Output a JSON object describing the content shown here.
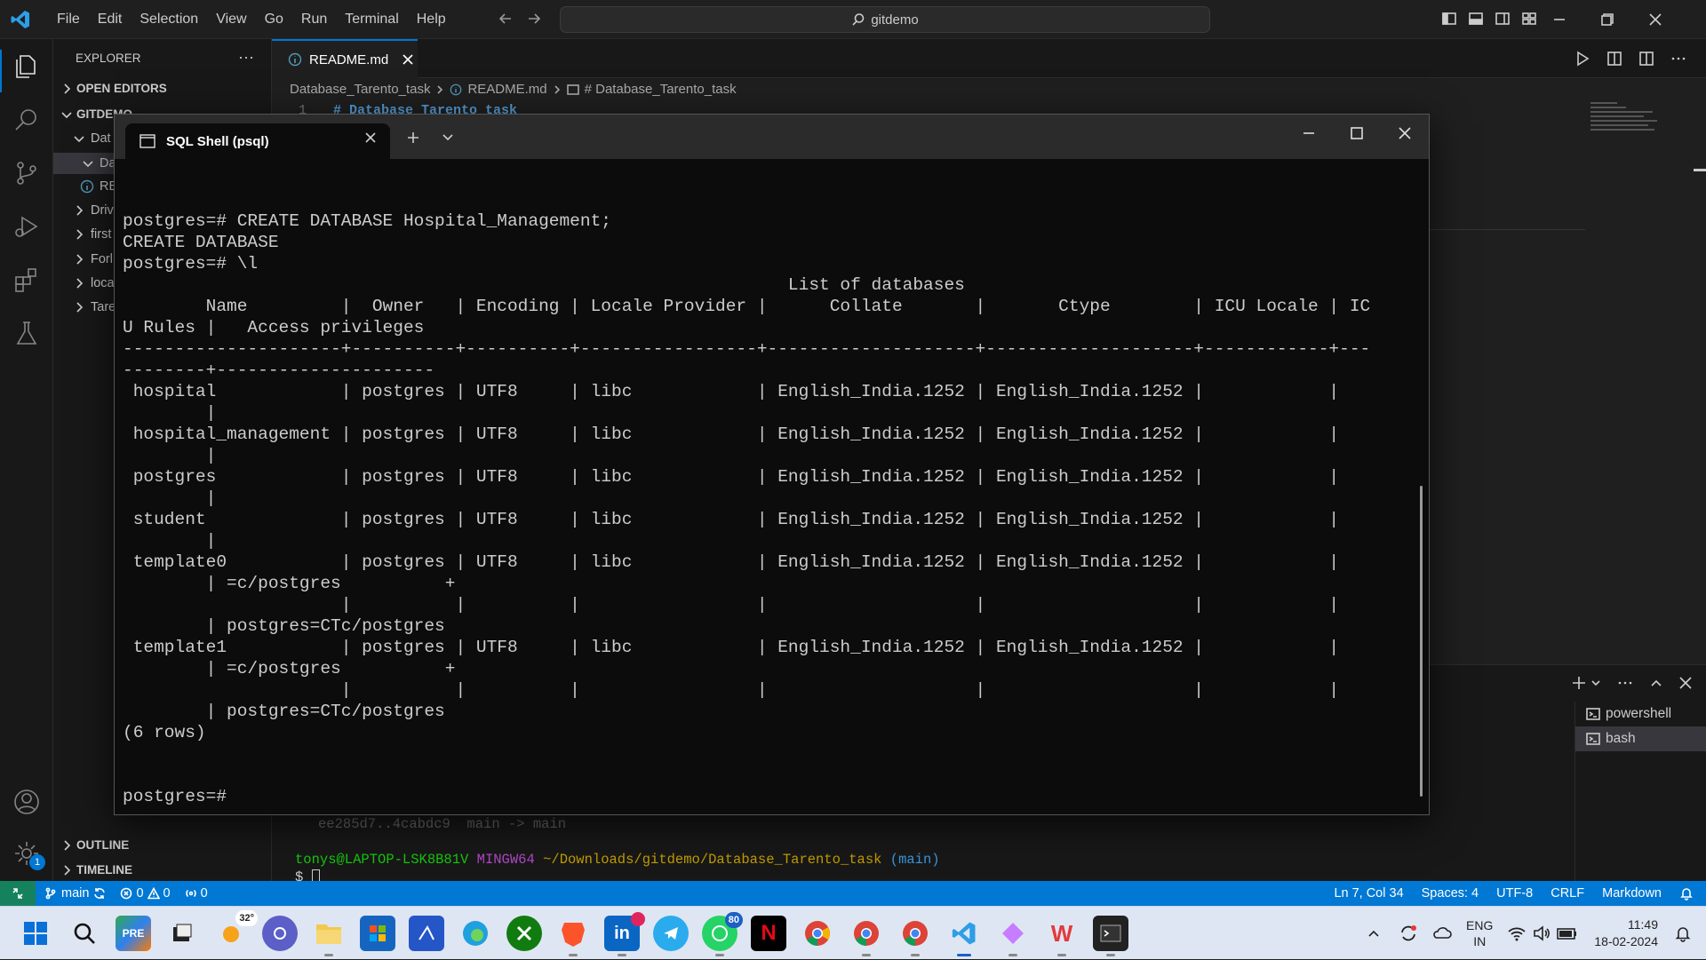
{
  "menu": [
    "File",
    "Edit",
    "Selection",
    "View",
    "Go",
    "Run",
    "Terminal",
    "Help"
  ],
  "search": {
    "text": "gitdemo"
  },
  "explorer": {
    "title": "EXPLORER",
    "more": "···",
    "open_editors": "OPEN EDITORS",
    "repo": "GITDEMO",
    "tree": [
      {
        "label": "Dat",
        "chevron": "down"
      },
      {
        "label": "Da",
        "chevron": "down"
      },
      {
        "label": "RE",
        "chevron": "info"
      },
      {
        "label": "Driv",
        "chevron": "right"
      },
      {
        "label": "first",
        "chevron": "right"
      },
      {
        "label": "Forl",
        "chevron": "right"
      },
      {
        "label": "loca",
        "chevron": "right"
      },
      {
        "label": "Tare",
        "chevron": "right"
      }
    ],
    "outline": "OUTLINE",
    "timeline": "TIMELINE"
  },
  "editor": {
    "tab": "README.md",
    "breadcrumb": [
      "Database_Tarento_task",
      "README.md",
      "# Database_Tarento_task"
    ],
    "line_number": "1",
    "line_text": "# Database_Tarento_task"
  },
  "psql": {
    "tab_title": "SQL Shell (psql)",
    "lines": [
      "",
      "",
      "postgres=# CREATE DATABASE Hospital_Management;",
      "CREATE DATABASE",
      "postgres=# \\l",
      "                                                                List of databases",
      "        Name         |  Owner   | Encoding | Locale Provider |      Collate       |       Ctype        | ICU Locale | IC",
      "U Rules |   Access privileges",
      "---------------------+----------+----------+-----------------+--------------------+--------------------+------------+---",
      "--------+---------------------",
      " hospital            | postgres | UTF8     | libc            | English_India.1252 | English_India.1252 |            |",
      "        |",
      " hospital_management | postgres | UTF8     | libc            | English_India.1252 | English_India.1252 |            |",
      "        |",
      " postgres            | postgres | UTF8     | libc            | English_India.1252 | English_India.1252 |            |",
      "        |",
      " student             | postgres | UTF8     | libc            | English_India.1252 | English_India.1252 |            |",
      "        |",
      " template0           | postgres | UTF8     | libc            | English_India.1252 | English_India.1252 |            |",
      "        | =c/postgres          +",
      "                     |          |          |                 |                    |                    |            |",
      "        | postgres=CTc/postgres",
      " template1           | postgres | UTF8     | libc            | English_India.1252 | English_India.1252 |            |",
      "        | =c/postgres          +",
      "                     |          |          |                 |                    |                    |            |",
      "        | postgres=CTc/postgres",
      "(6 rows)",
      "",
      "",
      "postgres=#"
    ]
  },
  "panel": {
    "terminals": [
      "powershell",
      "bash"
    ],
    "faded_line": "ee285d7..4cabdc9  main -> main",
    "prompt_user": "tonys@LAPTOP-LSK8B81V",
    "prompt_env": "MINGW64",
    "prompt_path": "~/Downloads/gitdemo/Database_Tarento_task",
    "prompt_branch": "(main)",
    "prompt_symbol": "$"
  },
  "status": {
    "branch": "main",
    "errors": "0",
    "warnings": "0",
    "ports": "0",
    "position": "Ln 7, Col 34",
    "spaces": "Spaces: 4",
    "encoding": "UTF-8",
    "eol": "CRLF",
    "language": "Markdown"
  },
  "taskbar": {
    "weather": "32°",
    "whatsapp_badge": "80",
    "lang1": "ENG",
    "lang2": "IN",
    "time": "11:49",
    "date": "18-02-2024",
    "settings_badge": "1"
  },
  "colors": {
    "accent": "#0078d4",
    "statusbar": "#0078d4",
    "remote": "#16825d"
  }
}
